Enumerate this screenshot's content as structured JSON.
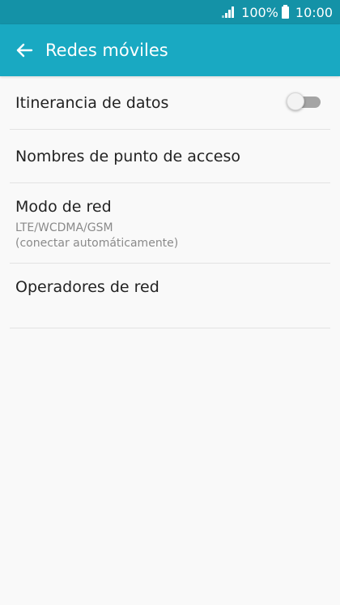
{
  "status_bar": {
    "battery_percent": "100%",
    "time": "10:00",
    "signal_icon": "signal-bars-icon",
    "battery_icon": "battery-icon"
  },
  "app_bar": {
    "back_icon": "arrow-left-icon",
    "title": "Redes móviles"
  },
  "settings": {
    "items": [
      {
        "label": "Itinerancia de datos",
        "toggle": {
          "state": "off"
        }
      },
      {
        "label": "Nombres de punto de acceso"
      },
      {
        "label": "Modo de red",
        "sub_line_1": "LTE/WCDMA/GSM",
        "sub_line_2": "(conectar automáticamente)"
      },
      {
        "label": "Operadores de red"
      }
    ]
  },
  "colors": {
    "status_bar": "#1492a7",
    "app_bar": "#19a9c2",
    "background": "#f9f9f9"
  }
}
